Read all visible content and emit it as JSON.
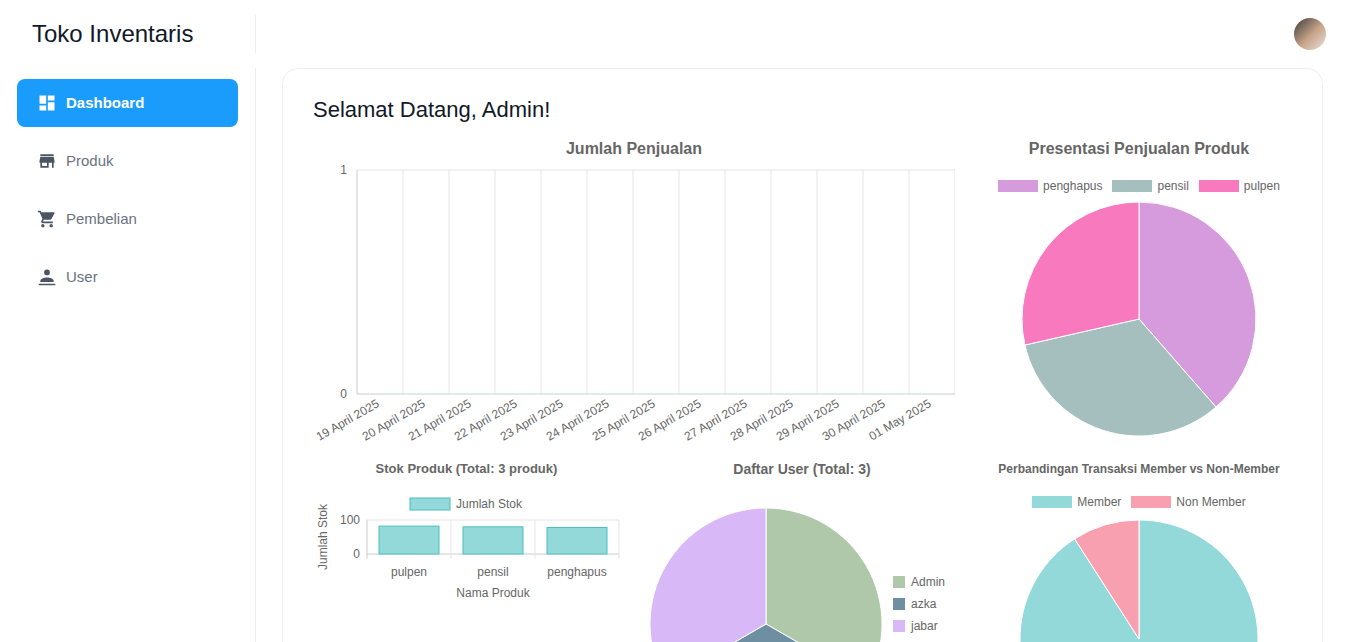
{
  "app": {
    "title": "Toko Inventaris"
  },
  "sidebar": {
    "items": [
      {
        "label": "Dashboard",
        "selected": true
      },
      {
        "label": "Produk",
        "selected": false
      },
      {
        "label": "Pembelian",
        "selected": false
      },
      {
        "label": "User",
        "selected": false
      }
    ]
  },
  "page": {
    "heading": "Selamat Datang, Admin!"
  },
  "charts": {
    "sales": {
      "title": "Jumlah Penjualan",
      "y_ticks": [
        "1",
        "0"
      ],
      "labels": [
        "19 April 2025",
        "20 April 2025",
        "21 April 2025",
        "22 April 2025",
        "23 April 2025",
        "24 April 2025",
        "25 April 2025",
        "26 April 2025",
        "27 April 2025",
        "28 April 2025",
        "29 April 2025",
        "30 April 2025",
        "01 May 2025"
      ],
      "values": [
        0,
        0,
        0,
        0,
        0,
        0,
        0,
        0,
        0,
        0,
        0,
        0,
        0
      ]
    },
    "product_share": {
      "title": "Presentasi Penjualan Produk",
      "slices": [
        {
          "label": "penghapus",
          "value": 27,
          "color": "#d69bdc"
        },
        {
          "label": "pensil",
          "value": 23,
          "color": "#a5bfbf"
        },
        {
          "label": "pulpen",
          "value": 20,
          "color": "#f879bd"
        }
      ]
    },
    "stock": {
      "title": "Stok Produk (Total: 3 produk)",
      "legend": "Jumlah Stok",
      "y_axis_title": "Jumlah Stok",
      "x_axis_title": "Nama Produk",
      "y_ticks": [
        "100",
        "0"
      ],
      "categories": [
        "pulpen",
        "pensil",
        "penghapus"
      ],
      "values": [
        82,
        80,
        78
      ]
    },
    "users": {
      "title": "Daftar User (Total: 3)",
      "slices": [
        {
          "label": "Admin",
          "value": 1,
          "color": "#b0c8aa"
        },
        {
          "label": "azka",
          "value": 1,
          "color": "#6e8fa2"
        },
        {
          "label": "jabar",
          "value": 1,
          "color": "#d8b8f7"
        }
      ]
    },
    "members": {
      "title": "Perbandingan Transaksi Member vs Non-Member",
      "slices": [
        {
          "label": "Member",
          "value": 10,
          "color": "#93d9d9"
        },
        {
          "label": "Non Member",
          "value": 1,
          "color": "#f9a0b0"
        }
      ]
    }
  }
}
